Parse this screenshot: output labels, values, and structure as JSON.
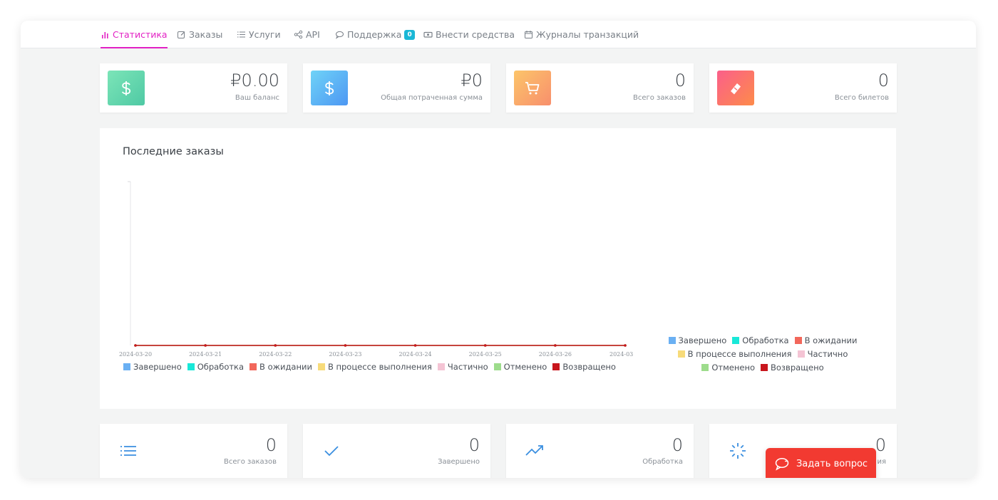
{
  "nav": {
    "items": [
      {
        "label": "Статистика",
        "icon": "bar-chart-icon"
      },
      {
        "label": "Заказы",
        "icon": "edit-icon"
      },
      {
        "label": "Услуги",
        "icon": "list-icon"
      },
      {
        "label": "API",
        "icon": "share-icon"
      },
      {
        "label": "Поддержка",
        "icon": "chat-icon",
        "badge": "0"
      },
      {
        "label": "Внести средства",
        "icon": "money-icon"
      },
      {
        "label": "Журналы транзакций",
        "icon": "calendar-icon"
      }
    ],
    "active_color": "#e221c4"
  },
  "stats": [
    {
      "value": "₽0.00",
      "label": "Ваш баланс",
      "icon": "dollar-icon"
    },
    {
      "value": "₽0",
      "label": "Общая потраченная сумма",
      "icon": "dollar-icon"
    },
    {
      "value": "0",
      "label": "Всего заказов",
      "icon": "cart-icon"
    },
    {
      "value": "0",
      "label": "Всего билетов",
      "icon": "ticket-icon"
    }
  ],
  "chart_section": {
    "title": "Последние заказы"
  },
  "chart_data": {
    "type": "line",
    "x": [
      "2024-03-20",
      "2024-03-21",
      "2024-03-22",
      "2024-03-23",
      "2024-03-24",
      "2024-03-25",
      "2024-03-26",
      "2024-03"
    ],
    "series": [
      {
        "name": "Завершено",
        "color": "#6ab0f3",
        "values": [
          0,
          0,
          0,
          0,
          0,
          0,
          0,
          0
        ]
      },
      {
        "name": "Обработка",
        "color": "#19e8d8",
        "values": [
          0,
          0,
          0,
          0,
          0,
          0,
          0,
          0
        ]
      },
      {
        "name": "В ожидании",
        "color": "#f2675b",
        "values": [
          0,
          0,
          0,
          0,
          0,
          0,
          0,
          0
        ]
      },
      {
        "name": "В процессе выполнения",
        "color": "#f7db7a",
        "values": [
          0,
          0,
          0,
          0,
          0,
          0,
          0,
          0
        ]
      },
      {
        "name": "Частично",
        "color": "#f4c4d4",
        "values": [
          0,
          0,
          0,
          0,
          0,
          0,
          0,
          0
        ]
      },
      {
        "name": "Отменено",
        "color": "#9ddc8c",
        "values": [
          0,
          0,
          0,
          0,
          0,
          0,
          0,
          0
        ]
      },
      {
        "name": "Возвращено",
        "color": "#c8161d",
        "values": [
          0,
          0,
          0,
          0,
          0,
          0,
          0,
          0
        ]
      }
    ],
    "grid": false,
    "legend": "bottom"
  },
  "bottom_stats": [
    {
      "value": "0",
      "label": "Всего заказов",
      "icon": "list-icon"
    },
    {
      "value": "0",
      "label": "Завершено",
      "icon": "check-icon"
    },
    {
      "value": "0",
      "label": "Обработка",
      "icon": "trending-up-icon"
    },
    {
      "value": "0",
      "label": "ия",
      "icon": "loader-icon"
    }
  ],
  "ask_button": {
    "label": "Задать вопрос",
    "color": "#f23a31"
  }
}
